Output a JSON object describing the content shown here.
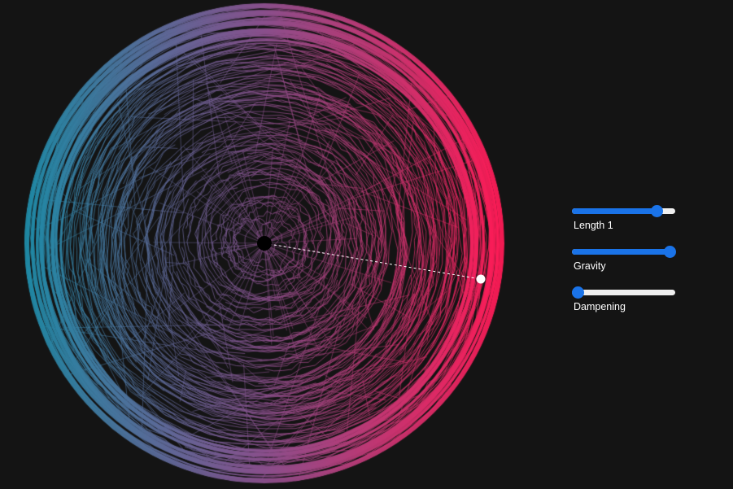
{
  "colors": {
    "background": "#141414",
    "trace_start": "#1e8aa6",
    "trace_end": "#ff1a55",
    "slider_accent": "#1a73e8",
    "slider_track": "#efefef",
    "pendulum_bob": "#ffffff",
    "pivot": "#000000"
  },
  "controls": [
    {
      "id": "length1",
      "label": "Length 1",
      "value_fraction": 0.86
    },
    {
      "id": "gravity",
      "label": "Gravity",
      "value_fraction": 1.0
    },
    {
      "id": "dampening",
      "label": "Dampening",
      "value_fraction": 0.0
    }
  ]
}
